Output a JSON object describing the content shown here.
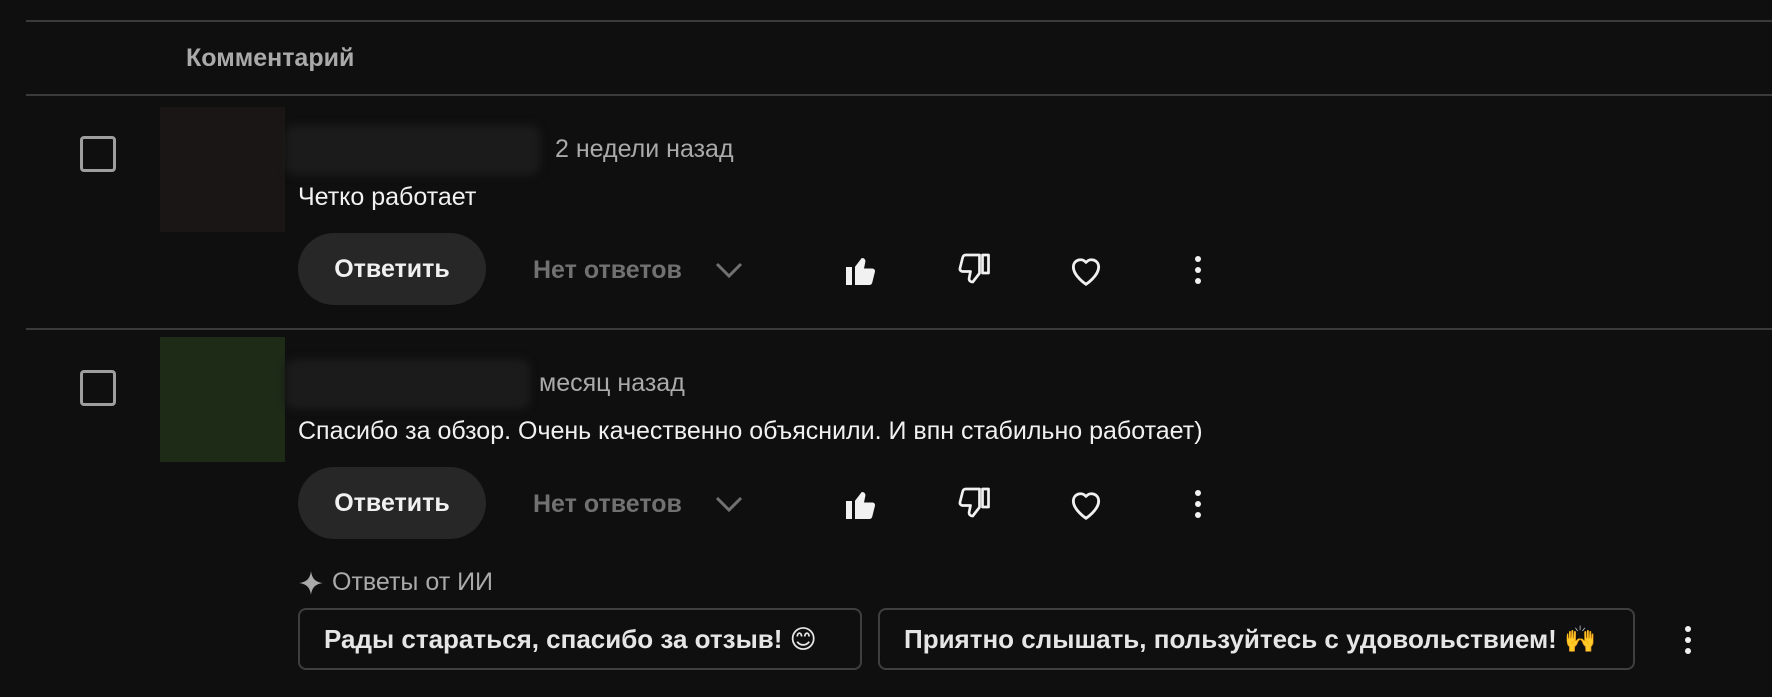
{
  "header": {
    "column_label": "Комментарий"
  },
  "comments": [
    {
      "time": "2 недели назад",
      "text": "Четко работает",
      "reply_label": "Ответить",
      "replies_label": "Нет ответов"
    },
    {
      "time": "месяц назад",
      "text": "Спасибо за обзор. Очень качественно объяснили. И впн стабильно работает)",
      "reply_label": "Ответить",
      "replies_label": "Нет ответов"
    }
  ],
  "ai": {
    "label": "Ответы от ИИ",
    "suggestions": [
      "Рады стараться, спасибо за отзыв! 😊",
      "Приятно слышать, пользуйтесь с удовольствием! 🙌"
    ]
  },
  "colors": {
    "background": "#0f0f0f",
    "button_bg": "#272727",
    "muted_text": "#aaaaaa",
    "divider": "#3a3a3a"
  },
  "icons": [
    "thumb-up-icon",
    "thumb-down-icon",
    "heart-icon",
    "more-vert-icon",
    "chevron-down-icon",
    "sparkle-icon"
  ]
}
